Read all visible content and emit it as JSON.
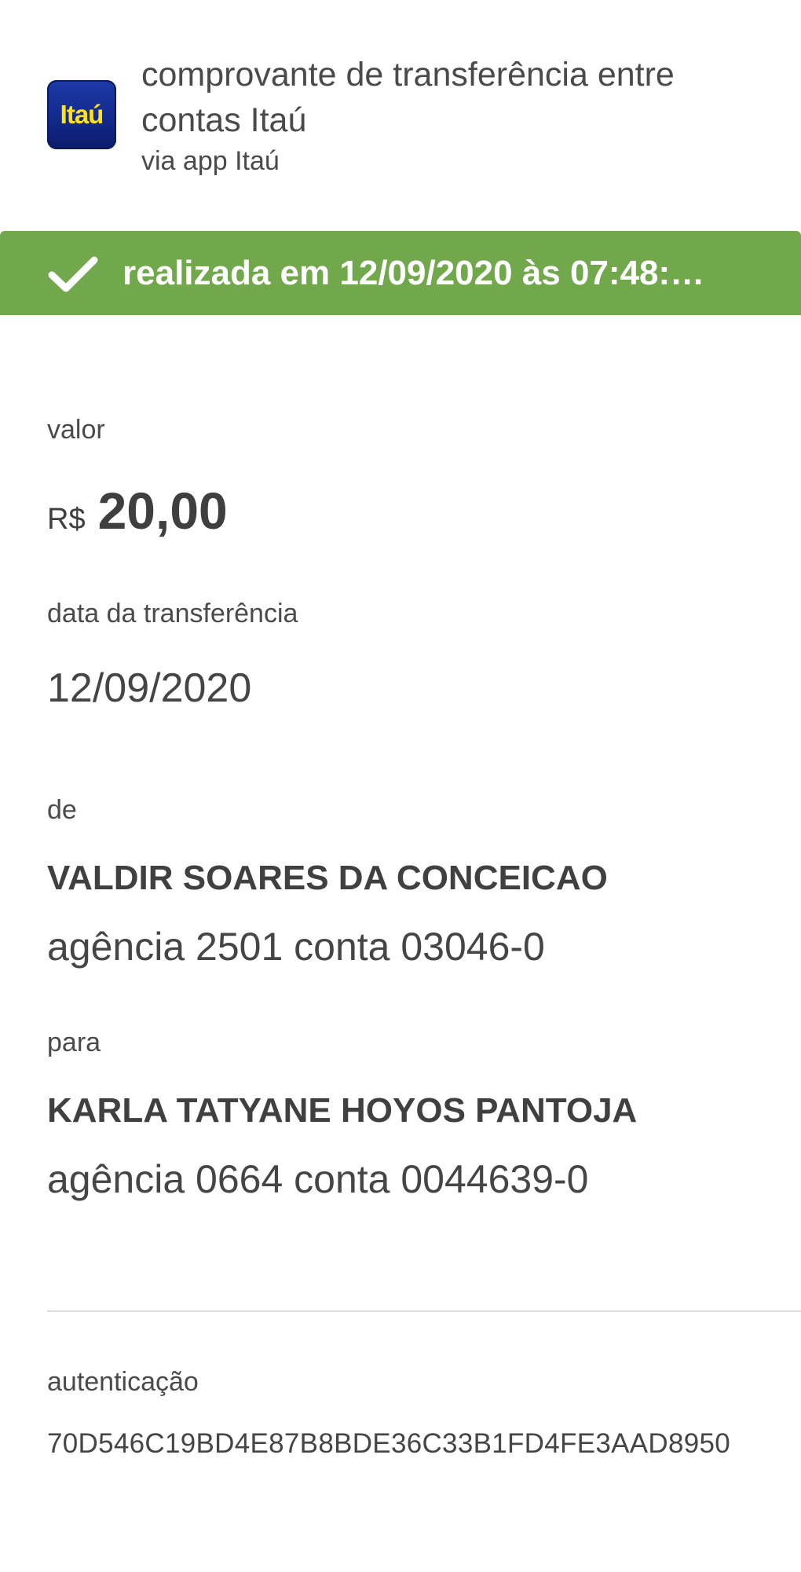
{
  "header": {
    "logo_text": "Itaú",
    "title": "comprovante de transferência entre contas Itaú",
    "subtitle": "via app Itaú"
  },
  "status": {
    "icon": "check-icon",
    "text": "realizada em 12/09/2020 às 07:48:…",
    "color": "#72a84c"
  },
  "valor": {
    "label": "valor",
    "currency": "R$",
    "amount": "20,00"
  },
  "data_transferencia": {
    "label": "data da transferência",
    "value": "12/09/2020"
  },
  "de": {
    "label": "de",
    "name": "VALDIR SOARES DA CONCEICAO",
    "account": "agência 2501 conta 03046-0"
  },
  "para": {
    "label": "para",
    "name": "KARLA TATYANE HOYOS PANTOJA",
    "account": "agência 0664 conta 0044639-0"
  },
  "autenticacao": {
    "label": "autenticação",
    "code": "70D546C19BD4E87B8BDE36C33B1FD4FE3AAD8950"
  }
}
